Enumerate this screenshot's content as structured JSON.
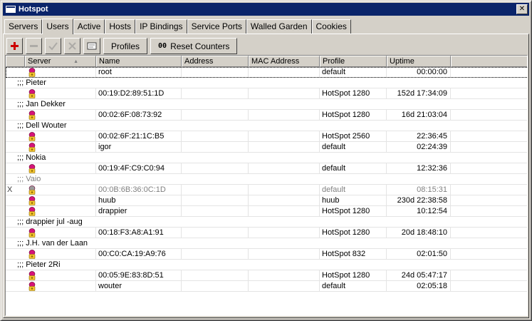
{
  "window": {
    "title": "Hotspot"
  },
  "tabs": [
    {
      "label": "Servers"
    },
    {
      "label": "Users"
    },
    {
      "label": "Active"
    },
    {
      "label": "Hosts"
    },
    {
      "label": "IP Bindings"
    },
    {
      "label": "Service Ports"
    },
    {
      "label": "Walled Garden"
    },
    {
      "label": "Cookies"
    }
  ],
  "active_tab": "Users",
  "toolbar": {
    "profiles_label": "Profiles",
    "reset_counters_label": "Reset Counters",
    "reset_prefix": "00"
  },
  "columns": {
    "server": "Server",
    "name": "Name",
    "address": "Address",
    "mac": "MAC Address",
    "profile": "Profile",
    "uptime": "Uptime"
  },
  "rows": [
    {
      "type": "user",
      "name": "root",
      "address": "",
      "mac": "",
      "profile": "default",
      "uptime": "00:00:00",
      "selected": true
    },
    {
      "type": "comment",
      "text": ";;; Pieter"
    },
    {
      "type": "user",
      "name": "00:19:D2:89:51:1D",
      "address": "",
      "mac": "",
      "profile": "HotSpot 1280",
      "uptime": "152d 17:34:09"
    },
    {
      "type": "comment",
      "text": ";;; Jan Dekker"
    },
    {
      "type": "user",
      "name": "00:02:6F:08:73:92",
      "address": "",
      "mac": "",
      "profile": "HotSpot 1280",
      "uptime": "16d 21:03:04"
    },
    {
      "type": "comment",
      "text": ";;; Dell Wouter"
    },
    {
      "type": "user",
      "name": "00:02:6F:21:1C:B5",
      "address": "",
      "mac": "",
      "profile": "HotSpot 2560",
      "uptime": "22:36:45"
    },
    {
      "type": "user",
      "name": "igor",
      "address": "",
      "mac": "",
      "profile": "default",
      "uptime": "02:24:39"
    },
    {
      "type": "comment",
      "text": ";;; Nokia"
    },
    {
      "type": "user",
      "name": "00:19:4F:C9:C0:94",
      "address": "",
      "mac": "",
      "profile": "default",
      "uptime": "12:32:36"
    },
    {
      "type": "comment",
      "text": ";;; Vaio",
      "disabled": true
    },
    {
      "type": "user",
      "name": "00:0B:6B:36:0C:1D",
      "address": "",
      "mac": "",
      "profile": "default",
      "uptime": "08:15:31",
      "disabled": true,
      "mark": "X"
    },
    {
      "type": "user",
      "name": "huub",
      "address": "",
      "mac": "",
      "profile": "huub",
      "uptime": "230d 22:38:58"
    },
    {
      "type": "user",
      "name": "drappier",
      "address": "",
      "mac": "",
      "profile": "HotSpot 1280",
      "uptime": "10:12:54"
    },
    {
      "type": "comment",
      "text": ";;; drappier jul -aug"
    },
    {
      "type": "user",
      "name": "00:18:F3:A8:A1:91",
      "address": "",
      "mac": "",
      "profile": "HotSpot 1280",
      "uptime": "20d 18:48:10"
    },
    {
      "type": "comment",
      "text": ";;; J.H. van der Laan"
    },
    {
      "type": "user",
      "name": "00:C0:CA:19:A9:76",
      "address": "",
      "mac": "",
      "profile": "HotSpot 832",
      "uptime": "02:01:50"
    },
    {
      "type": "comment",
      "text": ";;; Pieter 2Ri"
    },
    {
      "type": "user",
      "name": "00:05:9E:83:8D:51",
      "address": "",
      "mac": "",
      "profile": "HotSpot 1280",
      "uptime": "24d 05:47:17"
    },
    {
      "type": "user",
      "name": "wouter",
      "address": "",
      "mac": "",
      "profile": "default",
      "uptime": "02:05:18"
    }
  ],
  "icons": {
    "add": "plus-icon",
    "remove": "minus-icon",
    "enable": "check-icon",
    "disable": "x-icon",
    "comment": "comment-icon",
    "user": "user-icon"
  },
  "colors": {
    "titlebar": "#0a246a",
    "add": "#cc0000",
    "user_icon": "#d4147a"
  }
}
